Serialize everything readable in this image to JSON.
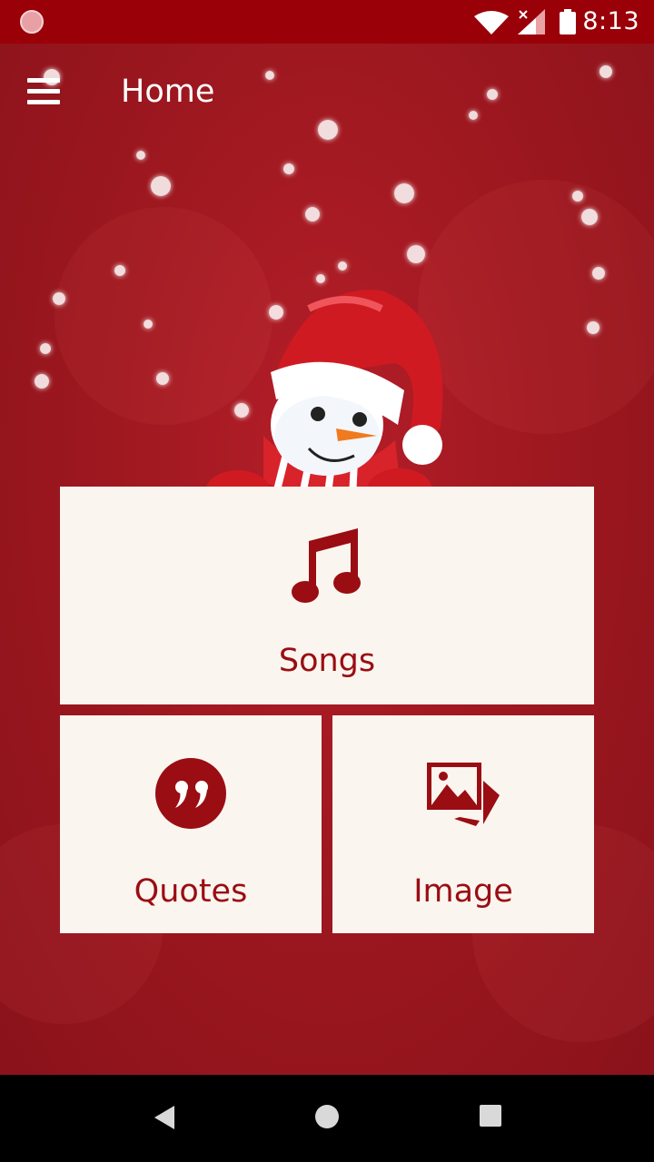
{
  "status_bar": {
    "time": "8:13",
    "icons": [
      "app-notification-icon",
      "wifi-icon",
      "signal-icon",
      "battery-icon"
    ]
  },
  "toolbar": {
    "title": "Home",
    "menu_icon": "hamburger-menu-icon"
  },
  "cards": {
    "songs": {
      "label": "Songs",
      "icon": "music-note-icon"
    },
    "quotes": {
      "label": "Quotes",
      "icon": "quote-icon"
    },
    "image": {
      "label": "Image",
      "icon": "image-gallery-icon"
    }
  },
  "nav_bar": {
    "icons": [
      "back-icon",
      "home-icon",
      "recents-icon"
    ]
  },
  "colors": {
    "status_bar": "#9a0008",
    "background": "#a81c24",
    "card_background": "#faf5ef",
    "accent": "#9a0d13"
  }
}
